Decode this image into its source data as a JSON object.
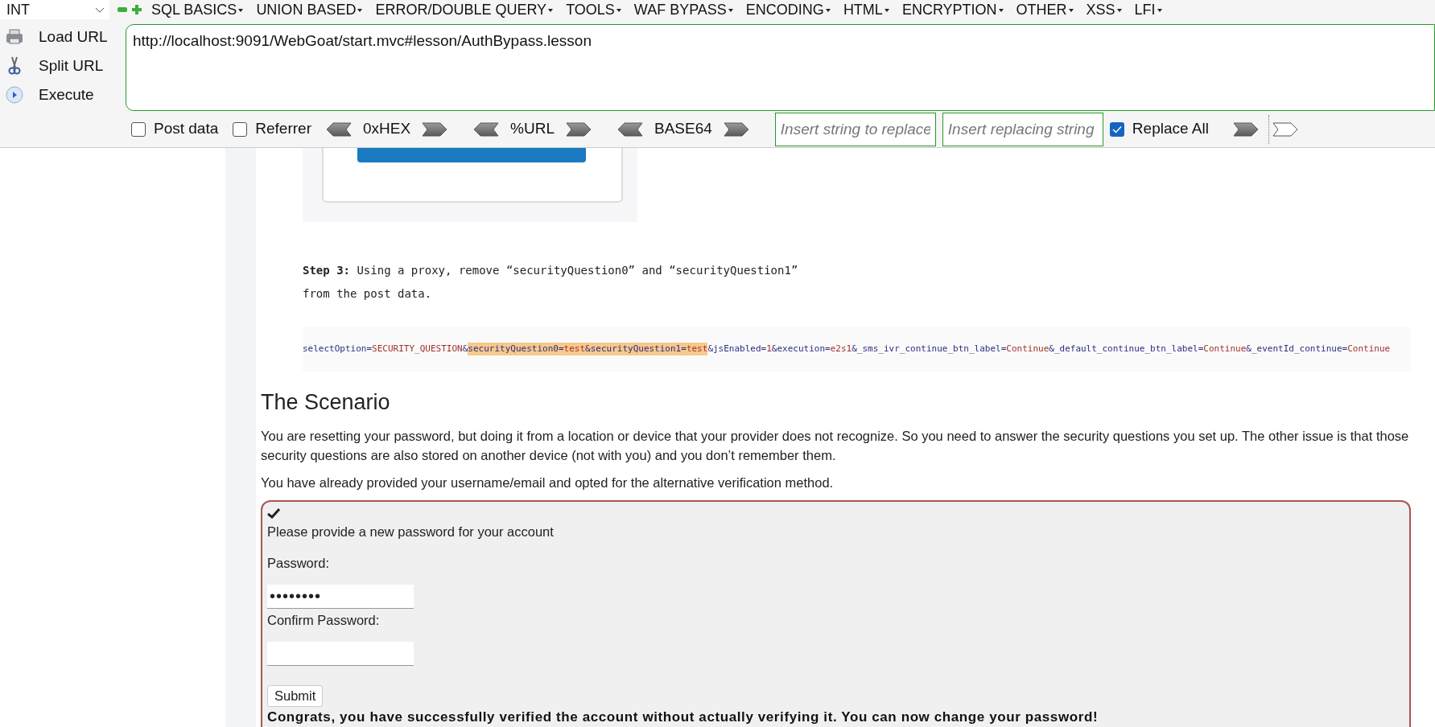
{
  "toolbar": {
    "mode_select": "INT",
    "menus": [
      {
        "label": "SQL BASICS"
      },
      {
        "label": "UNION BASED"
      },
      {
        "label": "ERROR/DOUBLE QUERY"
      },
      {
        "label": "TOOLS"
      },
      {
        "label": "WAF BYPASS"
      },
      {
        "label": "ENCODING"
      },
      {
        "label": "HTML"
      },
      {
        "label": "ENCRYPTION"
      },
      {
        "label": "OTHER"
      },
      {
        "label": "XSS"
      },
      {
        "label": "LFI"
      }
    ]
  },
  "actions": [
    {
      "kind": "load",
      "label": "Load URL"
    },
    {
      "kind": "split",
      "label": "Split URL"
    },
    {
      "kind": "execute",
      "label": "Execute"
    }
  ],
  "url": "http://localhost:9091/WebGoat/start.mvc#lesson/AuthBypass.lesson",
  "options": [
    {
      "kind": "checkbox",
      "label": "Post data",
      "checked": false
    },
    {
      "kind": "checkbox",
      "label": "Referrer",
      "checked": false
    },
    {
      "kind": "encoder",
      "label": "0xHEX"
    },
    {
      "kind": "encoder",
      "label": "%URL"
    },
    {
      "kind": "encoder",
      "label": "BASE64"
    },
    {
      "kind": "field",
      "placeholder": "Insert string to replace"
    },
    {
      "kind": "field",
      "placeholder": "Insert replacing string"
    },
    {
      "kind": "checkbox",
      "label": "Replace All",
      "checked": true
    },
    {
      "kind": "arrow"
    },
    {
      "kind": "divider"
    },
    {
      "kind": "blank-arrow"
    }
  ],
  "lesson": {
    "step_text": "**Step 3:** Using a proxy, remove “securityQuestion0” and “securityQuestion1”\nfrom the post data.",
    "code_segments": [
      {
        "text": "selectOption=",
        "kind": "key",
        "highlighted": false
      },
      {
        "text": "SECURITY_QUESTION",
        "kind": "value",
        "highlighted": false
      },
      {
        "text": "&",
        "kind": "key",
        "highlighted": false
      },
      {
        "text": "securityQuestion0=",
        "kind": "key",
        "highlighted": true
      },
      {
        "text": "test",
        "kind": "value",
        "highlighted": true
      },
      {
        "text": "&securityQuestion1=",
        "kind": "key",
        "highlighted": true
      },
      {
        "text": "test",
        "kind": "value",
        "highlighted": true
      },
      {
        "text": "&jsEnabled=",
        "kind": "key",
        "highlighted": false
      },
      {
        "text": "1",
        "kind": "value",
        "highlighted": false
      },
      {
        "text": "&execution=",
        "kind": "key",
        "highlighted": false
      },
      {
        "text": "e2s1",
        "kind": "value",
        "highlighted": false
      },
      {
        "text": "&_sms_ivr_continue_btn_label=",
        "kind": "key",
        "highlighted": false
      },
      {
        "text": "Continue",
        "kind": "value",
        "highlighted": false
      },
      {
        "text": "&_default_continue_btn_label=",
        "kind": "key",
        "highlighted": false
      },
      {
        "text": "Continue",
        "kind": "value",
        "highlighted": false
      },
      {
        "text": "&_eventId_continue=",
        "kind": "key",
        "highlighted": false
      },
      {
        "text": "Continue",
        "kind": "value",
        "highlighted": false
      }
    ],
    "heading": "The Scenario",
    "paragraphs": [
      "You are resetting your password, but doing it from a location or device that your provider does not recognize. So you need to answer the security questions you set up. The other issue is that those security questions are also stored on another device (not with you) and you don’t remember them.",
      "You have already provided your username/email and opted for the alternative verification method."
    ],
    "form": {
      "intro": "Please provide a new password for your account",
      "fields": [
        {
          "label": "Password:",
          "value": "••••••••"
        },
        {
          "label": "Confirm Password:"
        }
      ],
      "button": "Submit",
      "message": "Congrats, you have successfully verified the account without actually verifying it. You can now change your password!"
    }
  }
}
